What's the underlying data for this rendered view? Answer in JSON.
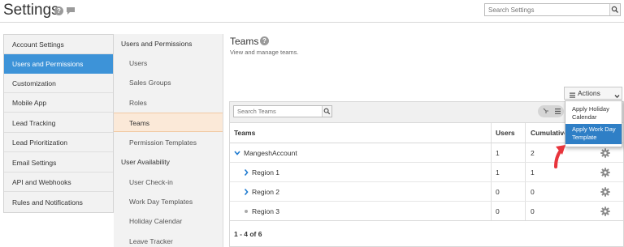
{
  "header": {
    "title": "Settings",
    "search_placeholder": "Search Settings"
  },
  "left_nav": {
    "items": [
      {
        "label": "Account Settings"
      },
      {
        "label": "Users and Permissions",
        "active": true
      },
      {
        "label": "Customization"
      },
      {
        "label": "Mobile App"
      },
      {
        "label": "Lead Tracking"
      },
      {
        "label": "Lead Prioritization"
      },
      {
        "label": "Email Settings"
      },
      {
        "label": "API and Webhooks"
      },
      {
        "label": "Rules and Notifications"
      }
    ]
  },
  "sub_nav": {
    "group1": "Users and Permissions",
    "group1_items": [
      "Users",
      "Sales Groups",
      "Roles",
      "Teams",
      "Permission Templates"
    ],
    "active_item": "Teams",
    "group2": "User Availability",
    "group2_items": [
      "User Check-in",
      "Work Day Templates",
      "Holiday Calendar",
      "Leave Tracker"
    ]
  },
  "main": {
    "title": "Teams",
    "subtitle": "View and manage teams.",
    "search_placeholder": "Search Teams",
    "actions_label": "Actions",
    "columns": [
      "Teams",
      "Users",
      "Cumulative"
    ],
    "rows": [
      {
        "name": "MangeshAccount",
        "users": "1",
        "cumulative": "2",
        "expander": "expanded",
        "level": 0
      },
      {
        "name": "Region 1",
        "users": "1",
        "cumulative": "1",
        "expander": "collapsed",
        "level": 1
      },
      {
        "name": "Region 2",
        "users": "0",
        "cumulative": "0",
        "expander": "collapsed",
        "level": 1
      },
      {
        "name": "Region 3",
        "users": "0",
        "cumulative": "0",
        "expander": "leaf",
        "level": 1
      }
    ],
    "pager": "1 - 4 of 6"
  },
  "actions_menu": {
    "items": [
      "Apply Holiday Calendar",
      "Apply Work Day Template"
    ],
    "highlighted": "Apply Work Day Template"
  },
  "colors": {
    "accent": "#3d93d8",
    "active_subnav": "#fbe9d8",
    "menu_highlight": "#2f7fc6",
    "annotation_arrow": "#e8343c"
  }
}
